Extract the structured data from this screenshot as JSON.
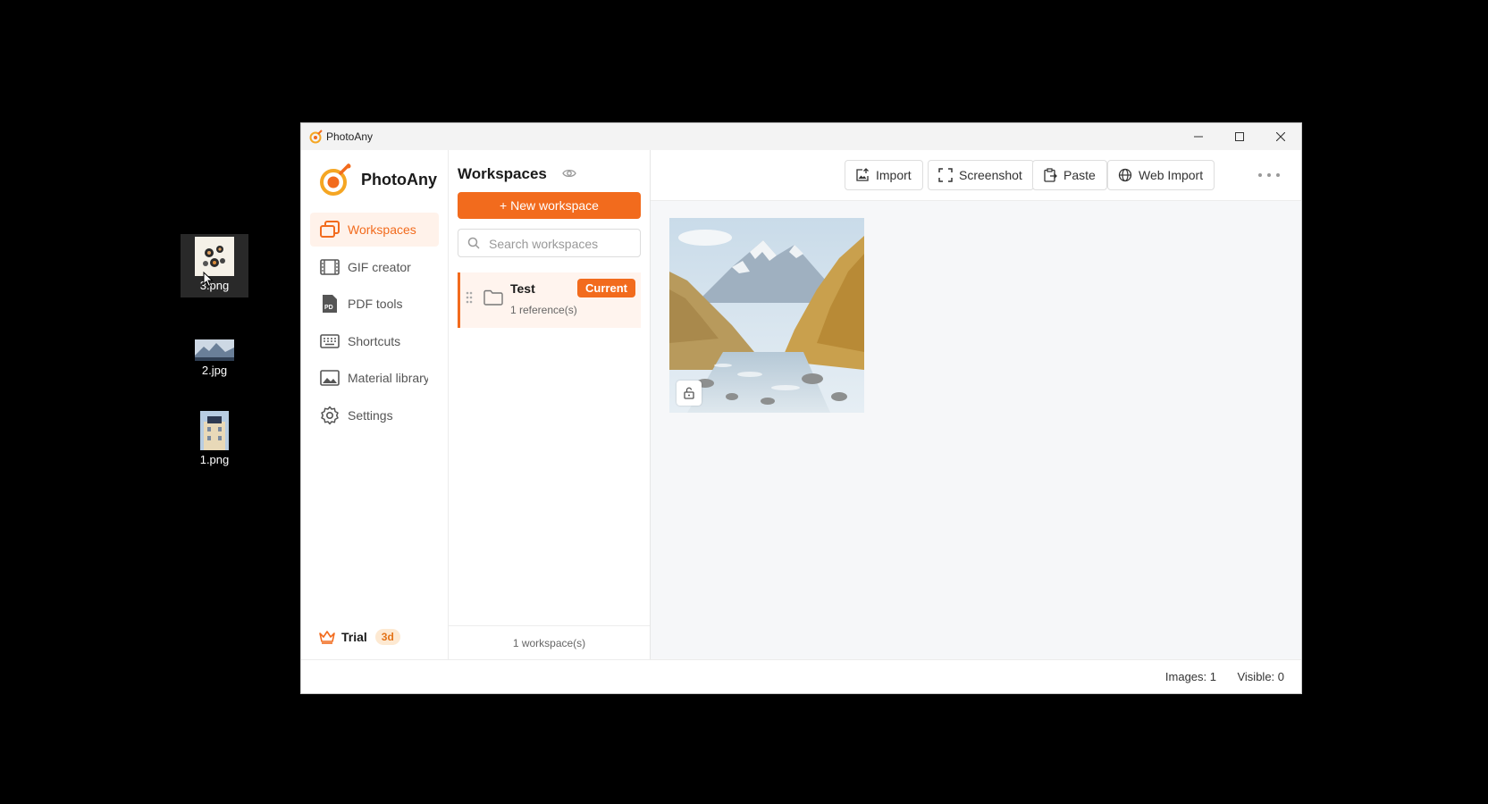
{
  "desktop": {
    "icons": [
      {
        "label": "3.png",
        "selected": true
      },
      {
        "label": "2.jpg",
        "selected": false
      },
      {
        "label": "1.png",
        "selected": false
      }
    ]
  },
  "window": {
    "title": "PhotoAny",
    "controls": {
      "minimize": "minimize-icon",
      "maximize": "maximize-icon",
      "close": "close-icon"
    }
  },
  "sidebar": {
    "brand": "PhotoAny",
    "items": [
      {
        "label": "Workspaces",
        "icon": "workspaces-icon",
        "active": true
      },
      {
        "label": "GIF creator",
        "icon": "gif-icon",
        "active": false
      },
      {
        "label": "PDF tools",
        "icon": "pdf-icon",
        "active": false
      },
      {
        "label": "Shortcuts",
        "icon": "keyboard-icon",
        "active": false
      },
      {
        "label": "Material library",
        "icon": "image-icon",
        "active": false
      },
      {
        "label": "Settings",
        "icon": "gear-icon",
        "active": false
      }
    ],
    "trial": {
      "label": "Trial",
      "badge": "3d"
    }
  },
  "workspaces_panel": {
    "title": "Workspaces",
    "new_button": "+ New workspace",
    "search_placeholder": "Search workspaces",
    "items": [
      {
        "name": "Test",
        "refs": "1 reference(s)",
        "badge": "Current"
      }
    ],
    "footer": "1 workspace(s)"
  },
  "toolbar": {
    "import": "Import",
    "screenshot": "Screenshot",
    "paste": "Paste",
    "web_import": "Web Import"
  },
  "status": {
    "images": "Images: 1",
    "visible": "Visible: 0"
  },
  "colors": {
    "accent": "#f26b1d",
    "accent_light": "#fff2ea"
  }
}
